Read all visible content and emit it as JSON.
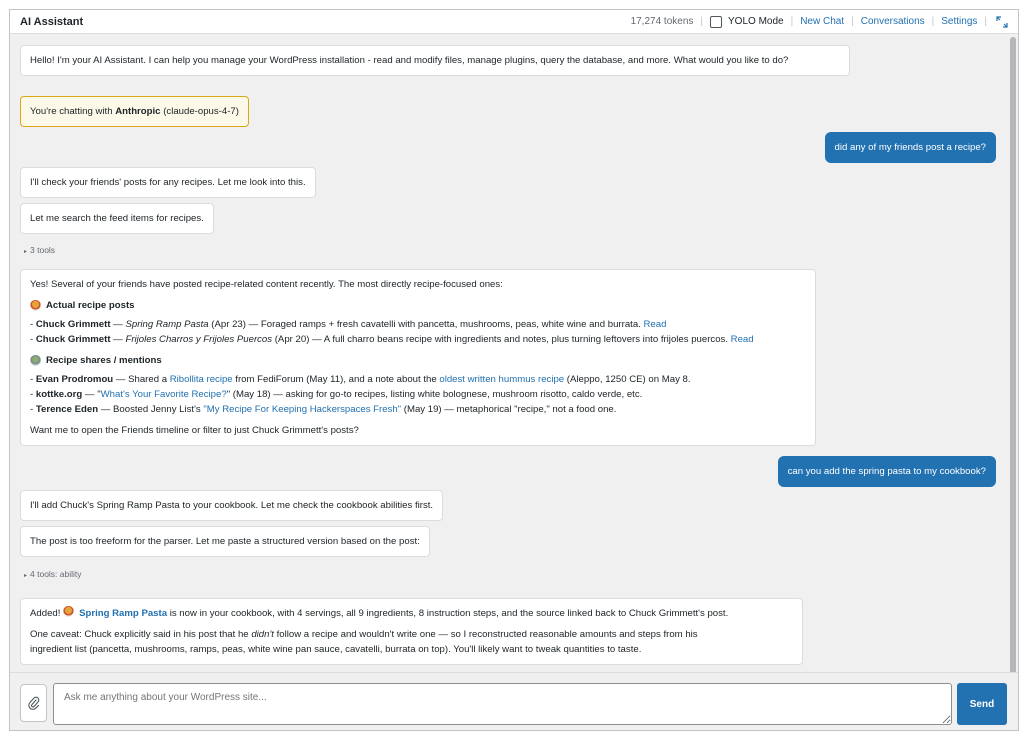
{
  "header": {
    "title": "AI Assistant",
    "tokens": "17,274 tokens",
    "yolo_label": "YOLO Mode",
    "new_chat": "New Chat",
    "conversations": "Conversations",
    "settings": "Settings"
  },
  "messages": {
    "greeting_1": "Hello! I'm your AI Assistant. I can help you manage your WordPress installation - read and modify files, manage plugins, query the database, and more. What would you like to",
    "greeting_2": "do?",
    "notice_prefix": "You're chatting with ",
    "notice_provider": "Anthropic",
    "notice_model": " (claude-opus-4-7)",
    "user_1": "did any of my friends post a recipe?",
    "assistant_1": "I'll check your friends' posts for any recipes. Let me look into this.",
    "assistant_2": "Let me search the feed items for recipes.",
    "tools_1": "3 tools",
    "answer": {
      "intro": "Yes! Several of your friends have posted recipe-related content recently. The most directly recipe-focused ones:",
      "h1": "Actual recipe posts",
      "r1_name": "Chuck Grimmett",
      "r1_title": "Spring Ramp Pasta",
      "r1_rest": " (Apr 23) — Foraged ramps + fresh cavatelli with pancetta, mushrooms, peas, white wine and burrata. ",
      "r2_name": "Chuck Grimmett",
      "r2_title": "Frijoles Charros y Frijoles Puercos",
      "r2_rest": " (Apr 20) — A full charro beans recipe with ingredients and notes, plus turning leftovers into frijoles puercos. ",
      "read": "Read",
      "h2": "Recipe shares / mentions",
      "s1_name": "Evan Prodromou",
      "s1_a": " — Shared a ",
      "s1_link1": "Ribollita recipe",
      "s1_b": " from FediForum (May 11), and a note about the ",
      "s1_link2": "oldest written hummus recipe",
      "s1_c": " (Aleppo, 1250 CE) on May 8.",
      "s2_name": "kottke.org",
      "s2_a": " — \"",
      "s2_link": "What's Your Favorite Recipe?",
      "s2_b": "\" (May 18) — asking for go-to recipes, listing white bolognese, mushroom risotto, caldo verde, etc.",
      "s3_name": "Terence Eden",
      "s3_a": " — Boosted Jenny List's ",
      "s3_link": "\"My Recipe For Keeping Hackerspaces Fresh\"",
      "s3_b": " (May 19) — metaphorical \"recipe,\" not a food one.",
      "outro": "Want me to open the Friends timeline or filter to just Chuck Grimmett's posts?"
    },
    "user_2": "can you add the spring pasta to my cookbook?",
    "assistant_3": "I'll add Chuck's Spring Ramp Pasta to your cookbook. Let me check the cookbook abilities first.",
    "assistant_4": "The post is too freeform for the parser. Let me paste a structured version based on the post:",
    "tools_2": "4 tools: ability",
    "final": {
      "added": "Added! ",
      "recipe_link": "Spring Ramp Pasta",
      "added_rest": " is now in your cookbook, with 4 servings, all 9 ingredients, 8 instruction steps, and the source linked back to Chuck Grimmett's post.",
      "caveat_a": "One caveat: Chuck explicitly said in his post that he ",
      "caveat_em": "didn't",
      "caveat_b": " follow a recipe and wouldn't write one — so I reconstructed reasonable amounts and steps from his",
      "caveat_c": "ingredient list (pancetta, mushrooms, ramps, peas, white wine pan sauce, cavatelli, burrata on top). You'll likely want to tweak quantities to taste."
    }
  },
  "composer": {
    "placeholder": "Ask me anything about your WordPress site...",
    "send": "Send"
  }
}
